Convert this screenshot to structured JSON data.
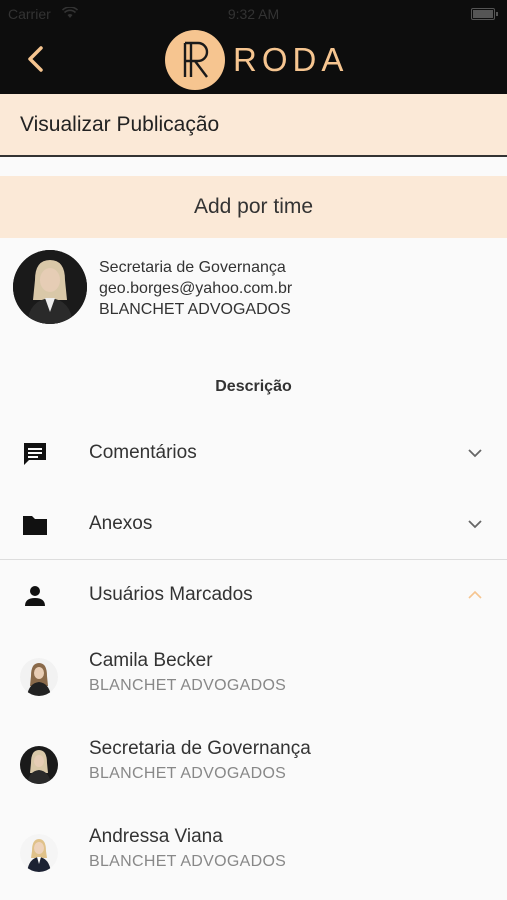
{
  "status_bar": {
    "carrier": "Carrier",
    "time": "9:32 AM"
  },
  "header": {
    "brand": "RODA",
    "logo_letter": "R"
  },
  "title_bar": {
    "title": "Visualizar Publicação"
  },
  "add_team": {
    "label": "Add por time"
  },
  "author": {
    "name": "Secretaria  de Governança",
    "email": "geo.borges@yahoo.com.br",
    "company": "BLANCHET ADVOGADOS"
  },
  "description": {
    "label": "Descrição"
  },
  "sections": [
    {
      "label": "Comentários",
      "icon": "comment-icon",
      "expanded": false
    },
    {
      "label": "Anexos",
      "icon": "folder-icon",
      "expanded": false
    },
    {
      "label": "Usuários Marcados",
      "icon": "person-icon",
      "expanded": true
    }
  ],
  "tagged_users": [
    {
      "name": "Camila Becker",
      "company": "BLANCHET ADVOGADOS"
    },
    {
      "name": "Secretaria  de Governança",
      "company": "BLANCHET ADVOGADOS"
    },
    {
      "name": "Andressa  Viana",
      "company": "BLANCHET ADVOGADOS"
    }
  ],
  "colors": {
    "accent": "#f6c590",
    "panel": "#fbe9d7",
    "header_bg": "#0d0d0d"
  }
}
